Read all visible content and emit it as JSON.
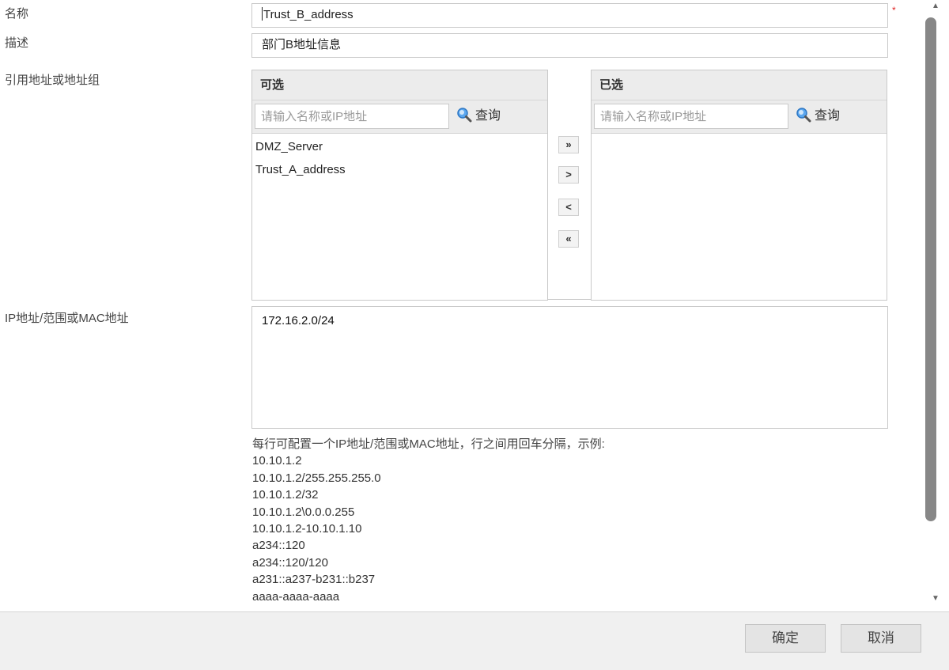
{
  "form": {
    "name_label": "名称",
    "name_value": "Trust_B_address",
    "required_mark": "*",
    "desc_label": "描述",
    "desc_value": "部门B地址信息",
    "ref_label": "引用地址或地址组",
    "ip_label": "IP地址/范围或MAC地址",
    "ip_value": "172.16.2.0/24"
  },
  "available": {
    "title": "可选",
    "search_placeholder": "请输入名称或IP地址",
    "search_label": "查询",
    "items": [
      "DMZ_Server",
      "Trust_A_address"
    ]
  },
  "selected": {
    "title": "已选",
    "search_placeholder": "请输入名称或IP地址",
    "search_label": "查询",
    "items": []
  },
  "transfer": {
    "add_all": "»",
    "add": ">",
    "remove": "<",
    "remove_all": "«"
  },
  "help": {
    "intro": "每行可配置一个IP地址/范围或MAC地址，行之间用回车分隔，示例:",
    "examples": [
      "10.10.1.2",
      "10.10.1.2/255.255.255.0",
      "10.10.1.2/32",
      "10.10.1.2\\0.0.0.255",
      "10.10.1.2-10.10.1.10",
      "a234::120",
      "a234::120/120",
      "a231::a237-b231::b237",
      "aaaa-aaaa-aaaa"
    ]
  },
  "footer": {
    "ok_label": "确定",
    "cancel_label": "取消"
  },
  "colors": {
    "panel_header_bg": "#ececec",
    "search_icon_blue": "#3a8ee6",
    "required_red": "#e02020",
    "footer_bg": "#f0f0f0"
  }
}
